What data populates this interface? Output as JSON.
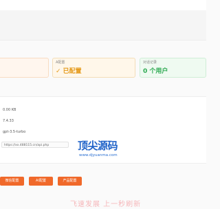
{
  "cards": {
    "a_label": "A配置",
    "a_value": "✓ 已配置",
    "b_label": "对话记录",
    "b_value": "0 个用户"
  },
  "details": {
    "size": "0.00 KB",
    "version": "7.4.33",
    "model": "gpt-3.5-turbo",
    "url": "https://xx.488115.cn/api.php"
  },
  "watermark": {
    "title": "顶尖源码",
    "subtitle": "www.djyuanma.com"
  },
  "buttons": {
    "b1": "微信配置",
    "b2": "AI配置",
    "b3": "产品配置"
  },
  "footer": {
    "text": "飞速发展 上一秒刷新"
  },
  "colors": {
    "accent": "#f0692a",
    "configured": "#e59a1a",
    "users": "#2eaa52"
  }
}
